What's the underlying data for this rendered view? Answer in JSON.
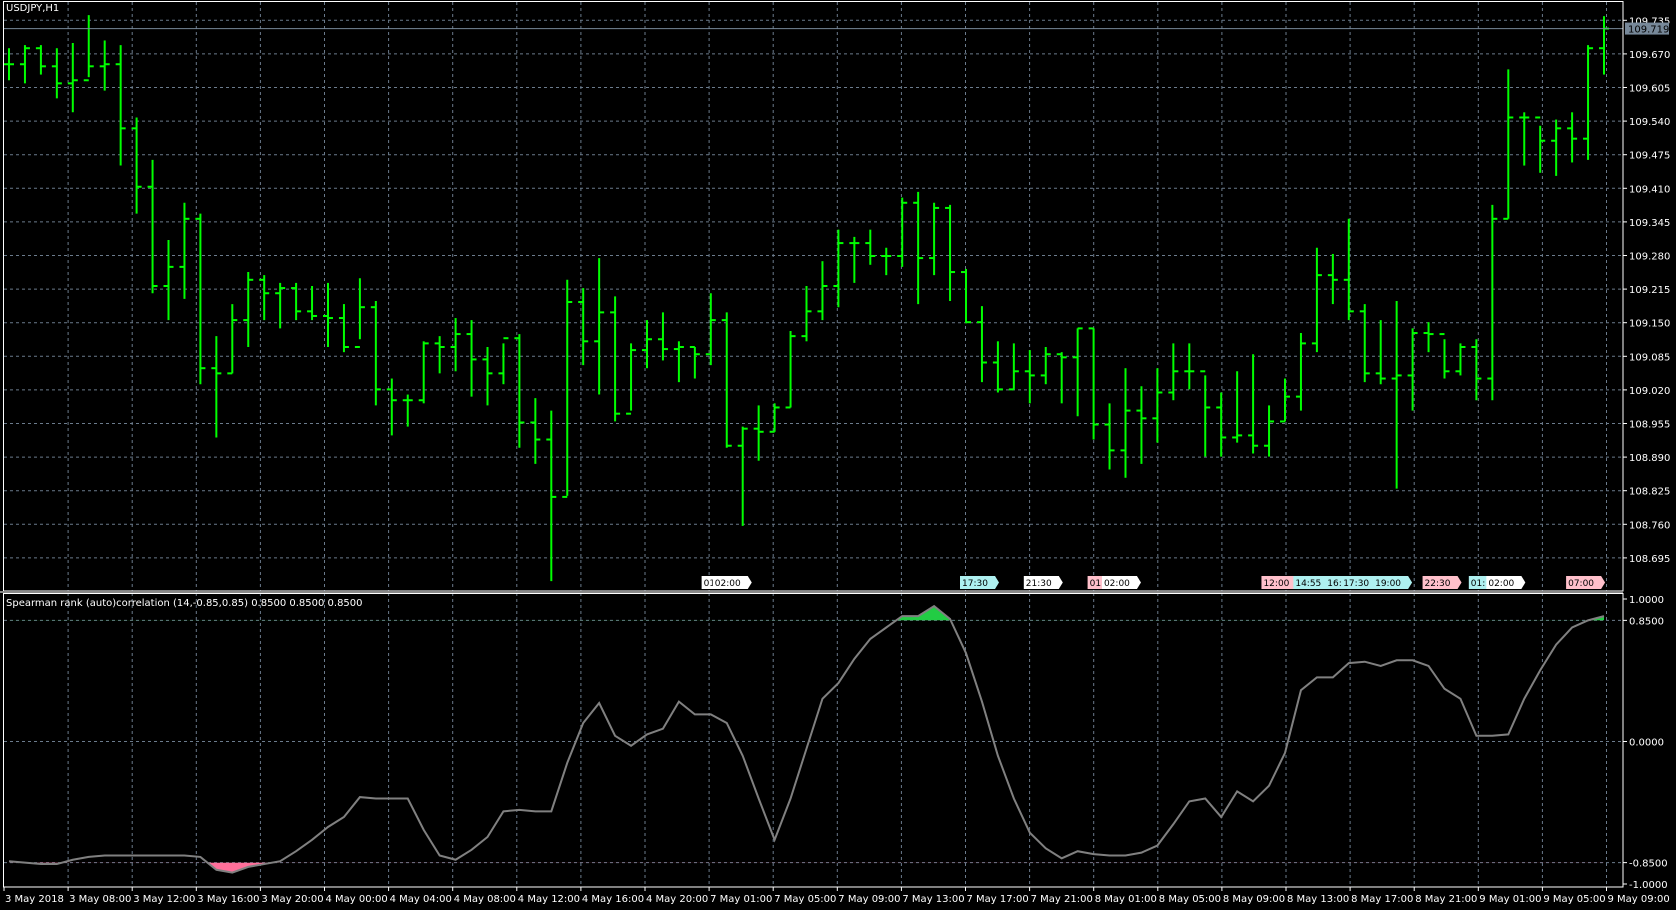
{
  "window": {
    "symbol_title": "USDJPY,H1"
  },
  "colors": {
    "background": "#000000",
    "bar": "#00ff00",
    "grid": "#6b7b8c",
    "axis": "#ffffff",
    "indicator_line": "#808080",
    "upper_fill": "#22cc44",
    "lower_fill": "#ff6f9a",
    "price_label_bg": "#778899",
    "event_white": "#ffffff",
    "event_cyan": "#aef0f0",
    "event_pink": "#ffc0cb"
  },
  "indicator": {
    "title": "Spearman rank (auto)correlation (14,-0.85,0.85) 0.8500 0.8500 0.8500"
  },
  "current_price": "109.719",
  "chart_data": [
    {
      "type": "ohlc",
      "title": "USDJPY,H1",
      "ylim": [
        108.65,
        109.76
      ],
      "price_ticks": [
        "109.735",
        "109.670",
        "109.605",
        "109.540",
        "109.475",
        "109.410",
        "109.345",
        "109.280",
        "109.215",
        "109.150",
        "109.085",
        "109.020",
        "108.955",
        "108.890",
        "108.825",
        "108.760",
        "108.695"
      ],
      "time_labels": [
        "3 May 2018",
        "3 May 08:00",
        "3 May 12:00",
        "3 May 16:00",
        "3 May 20:00",
        "4 May 00:00",
        "4 May 04:00",
        "4 May 08:00",
        "4 May 12:00",
        "4 May 16:00",
        "4 May 20:00",
        "7 May 01:00",
        "7 May 05:00",
        "7 May 09:00",
        "7 May 13:00",
        "7 May 17:00",
        "7 May 21:00",
        "8 May 01:00",
        "8 May 05:00",
        "8 May 09:00",
        "8 May 13:00",
        "8 May 17:00",
        "8 May 21:00",
        "9 May 01:00",
        "9 May 05:00",
        "9 May 09:00"
      ],
      "bars_hlc": [
        [
          109.681,
          109.619,
          109.65
        ],
        [
          109.687,
          109.613,
          109.681
        ],
        [
          109.687,
          109.63,
          109.646
        ],
        [
          109.681,
          109.584,
          109.613
        ],
        [
          109.691,
          109.557,
          109.619
        ],
        [
          109.745,
          109.625,
          109.646
        ],
        [
          109.696,
          109.599,
          109.65
        ],
        [
          109.687,
          109.454,
          109.526
        ],
        [
          109.547,
          109.361,
          109.413
        ],
        [
          109.465,
          109.207,
          109.221
        ],
        [
          109.31,
          109.155,
          109.258
        ],
        [
          109.382,
          109.196,
          109.351
        ],
        [
          109.361,
          109.031,
          109.062
        ],
        [
          109.124,
          108.928,
          109.052
        ],
        [
          109.186,
          109.052,
          109.155
        ],
        [
          109.248,
          109.103,
          109.233
        ],
        [
          109.242,
          109.155,
          109.207
        ],
        [
          109.227,
          109.139,
          109.217
        ],
        [
          109.227,
          109.155,
          109.172
        ],
        [
          109.221,
          109.155,
          109.163
        ],
        [
          109.227,
          109.103,
          109.159
        ],
        [
          109.186,
          109.093,
          109.103
        ],
        [
          109.236,
          109.118,
          109.18
        ],
        [
          109.192,
          108.99,
          109.021
        ],
        [
          109.042,
          108.932,
          109.0
        ],
        [
          109.011,
          108.949,
          109.0
        ],
        [
          109.114,
          108.994,
          109.11
        ],
        [
          109.124,
          109.052,
          109.103
        ],
        [
          109.159,
          109.056,
          109.128
        ],
        [
          109.155,
          109.007,
          109.079
        ],
        [
          109.103,
          108.99,
          109.052
        ],
        [
          109.11,
          109.031,
          109.12
        ],
        [
          109.128,
          108.908,
          108.957
        ],
        [
          109.004,
          108.877,
          108.924
        ],
        [
          108.98,
          108.65,
          108.813
        ],
        [
          109.233,
          108.815,
          109.19
        ],
        [
          109.217,
          109.068,
          109.114
        ],
        [
          109.275,
          109.011,
          109.17
        ],
        [
          109.201,
          108.959,
          108.974
        ],
        [
          109.11,
          108.98,
          109.097
        ],
        [
          109.155,
          109.062,
          109.118
        ],
        [
          109.17,
          109.077,
          109.099
        ],
        [
          109.114,
          109.035,
          109.103
        ],
        [
          109.103,
          109.042,
          109.089
        ],
        [
          109.207,
          109.068,
          109.155
        ],
        [
          109.17,
          108.908,
          108.912
        ],
        [
          108.949,
          108.757,
          108.945
        ],
        [
          108.99,
          108.883,
          108.939
        ],
        [
          108.994,
          108.939,
          108.986
        ],
        [
          109.134,
          108.986,
          109.124
        ],
        [
          109.221,
          109.114,
          109.172
        ],
        [
          109.269,
          109.155,
          109.221
        ],
        [
          109.33,
          109.18,
          109.304
        ],
        [
          109.316,
          109.227,
          109.304
        ],
        [
          109.33,
          109.262,
          109.279
        ],
        [
          109.295,
          109.242,
          109.279
        ],
        [
          109.392,
          109.258,
          109.382
        ],
        [
          109.403,
          109.186,
          109.275
        ],
        [
          109.382,
          109.242,
          109.372
        ],
        [
          109.378,
          109.192,
          109.248
        ],
        [
          109.254,
          109.149,
          109.151
        ],
        [
          109.182,
          109.035,
          109.073
        ],
        [
          109.114,
          109.015,
          109.021
        ],
        [
          109.11,
          109.021,
          109.056
        ],
        [
          109.097,
          108.994,
          109.048
        ],
        [
          109.103,
          109.031,
          109.089
        ],
        [
          109.093,
          108.994,
          109.083
        ],
        [
          109.139,
          108.969,
          109.139
        ],
        [
          109.139,
          108.924,
          108.953
        ],
        [
          108.994,
          108.866,
          108.903
        ],
        [
          109.062,
          108.85,
          108.98
        ],
        [
          109.027,
          108.877,
          108.965
        ],
        [
          109.062,
          108.918,
          109.015
        ],
        [
          109.11,
          109.0,
          109.056
        ],
        [
          109.11,
          109.021,
          109.056
        ],
        [
          109.048,
          108.891,
          108.986
        ],
        [
          109.015,
          108.891,
          108.928
        ],
        [
          109.056,
          108.918,
          108.932
        ],
        [
          109.089,
          108.897,
          108.912
        ],
        [
          108.99,
          108.891,
          108.959
        ],
        [
          109.042,
          108.959,
          109.007
        ],
        [
          109.13,
          108.98,
          109.11
        ],
        [
          109.295,
          109.093,
          109.242
        ],
        [
          109.283,
          109.186,
          109.233
        ],
        [
          109.351,
          109.155,
          109.172
        ],
        [
          109.186,
          109.035,
          109.052
        ],
        [
          109.155,
          109.031,
          109.042
        ],
        [
          109.192,
          108.829,
          109.048
        ],
        [
          109.139,
          108.98,
          109.13
        ],
        [
          109.151,
          109.093,
          109.128
        ],
        [
          109.118,
          109.042,
          109.056
        ],
        [
          109.11,
          109.048,
          109.103
        ],
        [
          109.118,
          109.0,
          109.042
        ],
        [
          109.378,
          109.0,
          109.351
        ],
        [
          109.64,
          109.351,
          109.547
        ],
        [
          109.557,
          109.454,
          109.547
        ],
        [
          109.531,
          109.44,
          109.502
        ],
        [
          109.543,
          109.434,
          109.526
        ],
        [
          109.557,
          109.46,
          109.506
        ],
        [
          109.687,
          109.465,
          109.681
        ],
        [
          109.743,
          109.63,
          109.719
        ]
      ],
      "events": [
        {
          "label": "01:",
          "time_index": 43.8,
          "color": "white"
        },
        {
          "label": "02:00",
          "time_index": 44.5,
          "color": "white"
        },
        {
          "label": "17:30",
          "time_index": 60,
          "color": "cyan"
        },
        {
          "label": "21:30",
          "time_index": 64,
          "color": "white"
        },
        {
          "label": "01:",
          "time_index": 68,
          "color": "pink"
        },
        {
          "label": "02:00",
          "time_index": 68.9,
          "color": "white"
        },
        {
          "label": "12:00",
          "time_index": 78.9,
          "color": "pink"
        },
        {
          "label": "14:55",
          "time_index": 80.9,
          "color": "cyan"
        },
        {
          "label": "16:",
          "time_index": 82.9,
          "color": "cyan"
        },
        {
          "label": "17:30",
          "time_index": 83.9,
          "color": "cyan"
        },
        {
          "label": "19:00",
          "time_index": 85.9,
          "color": "cyan"
        },
        {
          "label": "22:30",
          "time_index": 89,
          "color": "pink"
        },
        {
          "label": "01:",
          "time_index": 91.9,
          "color": "cyan"
        },
        {
          "label": "02:00",
          "time_index": 93,
          "color": "white"
        },
        {
          "label": "07:00",
          "time_index": 98,
          "color": "pink"
        }
      ]
    },
    {
      "type": "line",
      "title": "Spearman rank (auto)correlation (14,-0.85,0.85)",
      "ylim": [
        -1,
        1
      ],
      "levels": [
        0.85,
        0,
        -0.85
      ],
      "y_ticks": [
        "1.0000",
        "0.8500",
        "0.0000",
        "-0.8500",
        "-1.0000"
      ],
      "values": [
        -0.84,
        -0.85,
        -0.86,
        -0.86,
        -0.83,
        -0.81,
        -0.8,
        -0.8,
        -0.8,
        -0.8,
        -0.8,
        -0.8,
        -0.81,
        -0.9,
        -0.92,
        -0.88,
        -0.86,
        -0.84,
        -0.77,
        -0.69,
        -0.6,
        -0.53,
        -0.39,
        -0.4,
        -0.4,
        -0.4,
        -0.62,
        -0.8,
        -0.83,
        -0.76,
        -0.67,
        -0.49,
        -0.48,
        -0.49,
        -0.49,
        -0.15,
        0.13,
        0.27,
        0.04,
        -0.03,
        0.05,
        0.09,
        0.28,
        0.19,
        0.19,
        0.13,
        -0.1,
        -0.4,
        -0.69,
        -0.4,
        -0.05,
        0.3,
        0.41,
        0.58,
        0.72,
        0.8,
        0.88,
        0.88,
        0.95,
        0.86,
        0.62,
        0.28,
        -0.1,
        -0.4,
        -0.64,
        -0.75,
        -0.82,
        -0.77,
        -0.79,
        -0.8,
        -0.8,
        -0.78,
        -0.73,
        -0.58,
        -0.42,
        -0.4,
        -0.53,
        -0.35,
        -0.42,
        -0.31,
        -0.08,
        0.36,
        0.45,
        0.45,
        0.55,
        0.56,
        0.53,
        0.57,
        0.57,
        0.53,
        0.37,
        0.3,
        0.04,
        0.04,
        0.05,
        0.3,
        0.5,
        0.68,
        0.8,
        0.85,
        0.88
      ]
    }
  ]
}
